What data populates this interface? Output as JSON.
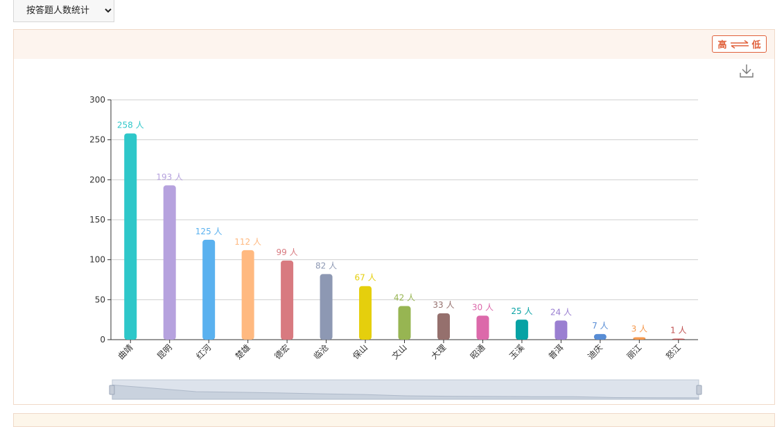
{
  "filter": {
    "selected": "按答题人数统计"
  },
  "toolbar": {
    "sort_high": "高",
    "sort_low": "低"
  },
  "icons": {
    "download": "download-icon",
    "swap": "swap-arrows-icon"
  },
  "colors": {
    "accent": "#e0603a",
    "panel_border": "#f0d9c8",
    "panel_head": "#fdf4ee"
  },
  "chart_data": {
    "type": "bar",
    "title": "",
    "xlabel": "",
    "ylabel": "",
    "ylim": [
      0,
      300
    ],
    "yticks": [
      0,
      50,
      100,
      150,
      200,
      250,
      300
    ],
    "grid": true,
    "label_suffix": " 人",
    "categories": [
      "曲靖",
      "昆明",
      "红河",
      "楚雄",
      "德宏",
      "临沧",
      "保山",
      "文山",
      "大理",
      "昭通",
      "玉溪",
      "普洱",
      "迪庆",
      "丽江",
      "怒江"
    ],
    "values": [
      258,
      193,
      125,
      112,
      99,
      82,
      67,
      42,
      33,
      30,
      25,
      24,
      7,
      3,
      1
    ],
    "colors": [
      "#2ec7c9",
      "#b6a2de",
      "#5ab1ef",
      "#ffb980",
      "#d87a80",
      "#8d98b3",
      "#e5cf0d",
      "#97b552",
      "#95706d",
      "#dc69aa",
      "#07a2a4",
      "#9a7fd1",
      "#588dd5",
      "#f5994e",
      "#c05050"
    ]
  }
}
